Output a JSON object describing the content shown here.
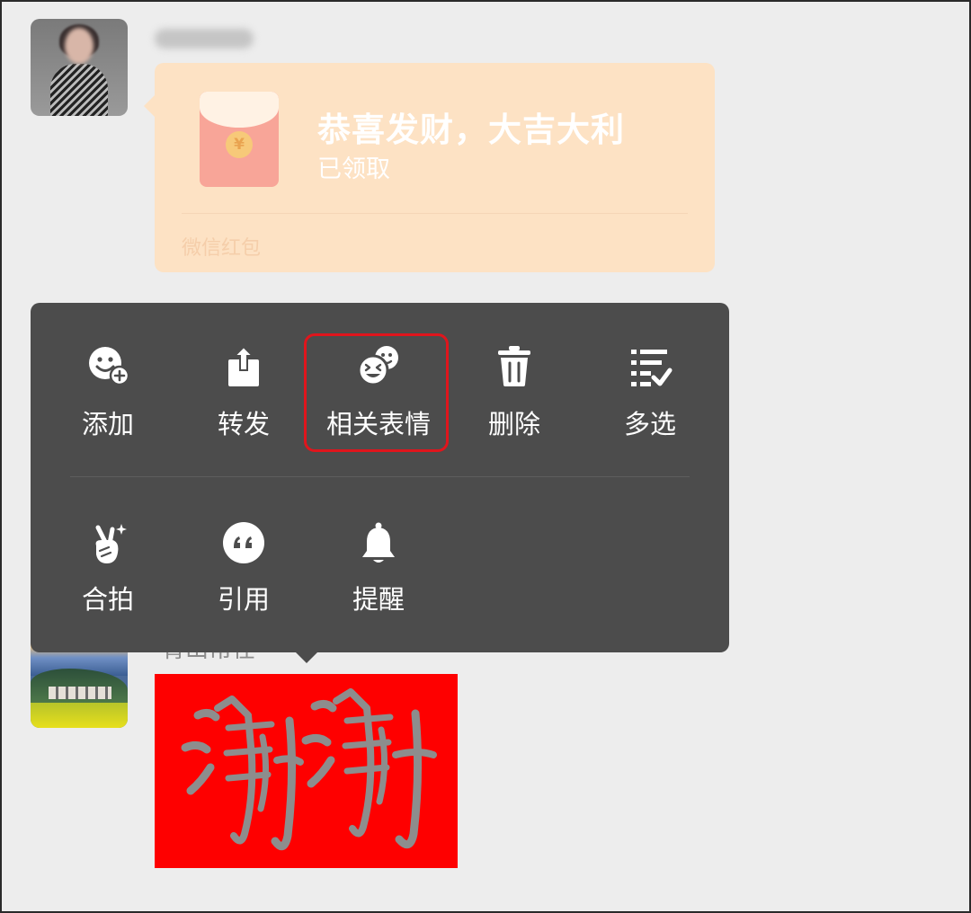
{
  "messages": [
    {
      "type": "red_packet",
      "red_packet": {
        "title": "恭喜发财，大吉大利",
        "status": "已领取",
        "source": "微信红包",
        "coin_symbol": "¥"
      }
    },
    {
      "type": "sticker",
      "sender_name": "青山常在"
    }
  ],
  "context_menu": {
    "items": [
      {
        "label": "添加",
        "icon": "add-sticker-icon"
      },
      {
        "label": "转发",
        "icon": "share-icon"
      },
      {
        "label": "相关表情",
        "icon": "related-stickers-icon",
        "highlighted": true
      },
      {
        "label": "删除",
        "icon": "trash-icon"
      },
      {
        "label": "多选",
        "icon": "multi-select-icon"
      },
      {
        "label": "合拍",
        "icon": "duet-icon"
      },
      {
        "label": "引用",
        "icon": "quote-icon"
      },
      {
        "label": "提醒",
        "icon": "bell-icon"
      }
    ]
  },
  "colors": {
    "background": "#ededed",
    "menu_background": "#4c4c4c",
    "red_packet_bubble": "#fde2c4",
    "red_packet_icon": "#f8a598",
    "highlight": "#e0151c",
    "sticker_background": "#fe0000",
    "sticker_ink": "#8d8d8d"
  }
}
